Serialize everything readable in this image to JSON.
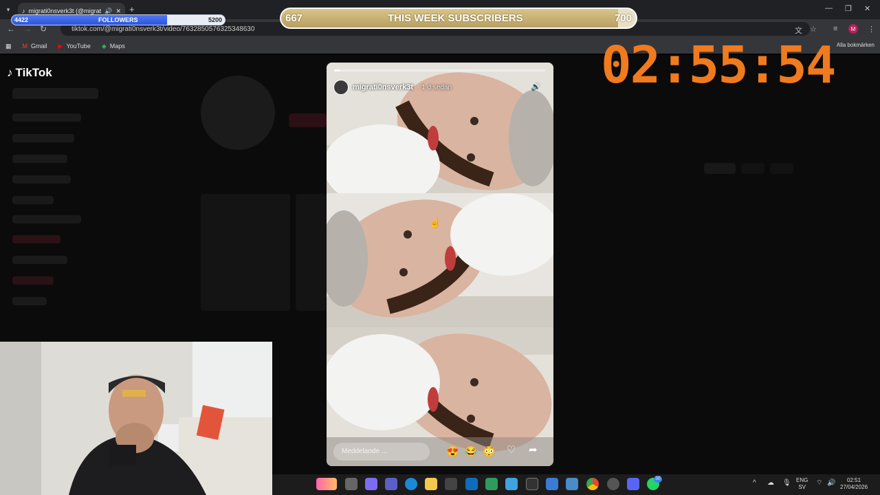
{
  "browser": {
    "tab_title": "migrati0nsverk3t (@migrati",
    "url": "tiktok.com/@migrati0nsverk3t/video/7632850576325348630",
    "bookmarks": [
      "Gmail",
      "YouTube",
      "Maps"
    ],
    "bookmarks_all": "Alla bokmärken",
    "profile_initial": "M"
  },
  "tiktok": {
    "logo_text": "TikTok"
  },
  "followers_bar": {
    "label": "FOLLOWERS",
    "start": "4422",
    "goal": "5200",
    "progress": 0.73
  },
  "subs_bar": {
    "label": "THIS WEEK SUBSCRIBERS",
    "start": "667",
    "goal": "700",
    "progress": 0.95
  },
  "timer": "02:55:54",
  "story": {
    "username": "migrati0nsverk3t",
    "time_ago": "· 1 d sedan",
    "message_placeholder": "Meddelande ...",
    "progress": 0.03,
    "emojis": [
      "😍",
      "😂",
      "😳"
    ]
  },
  "taskbar": {
    "lang_top": "ENG",
    "lang_bottom": "SV",
    "clock_time": "02:51",
    "clock_date": "27/04/2026",
    "badges": [
      "36"
    ]
  }
}
